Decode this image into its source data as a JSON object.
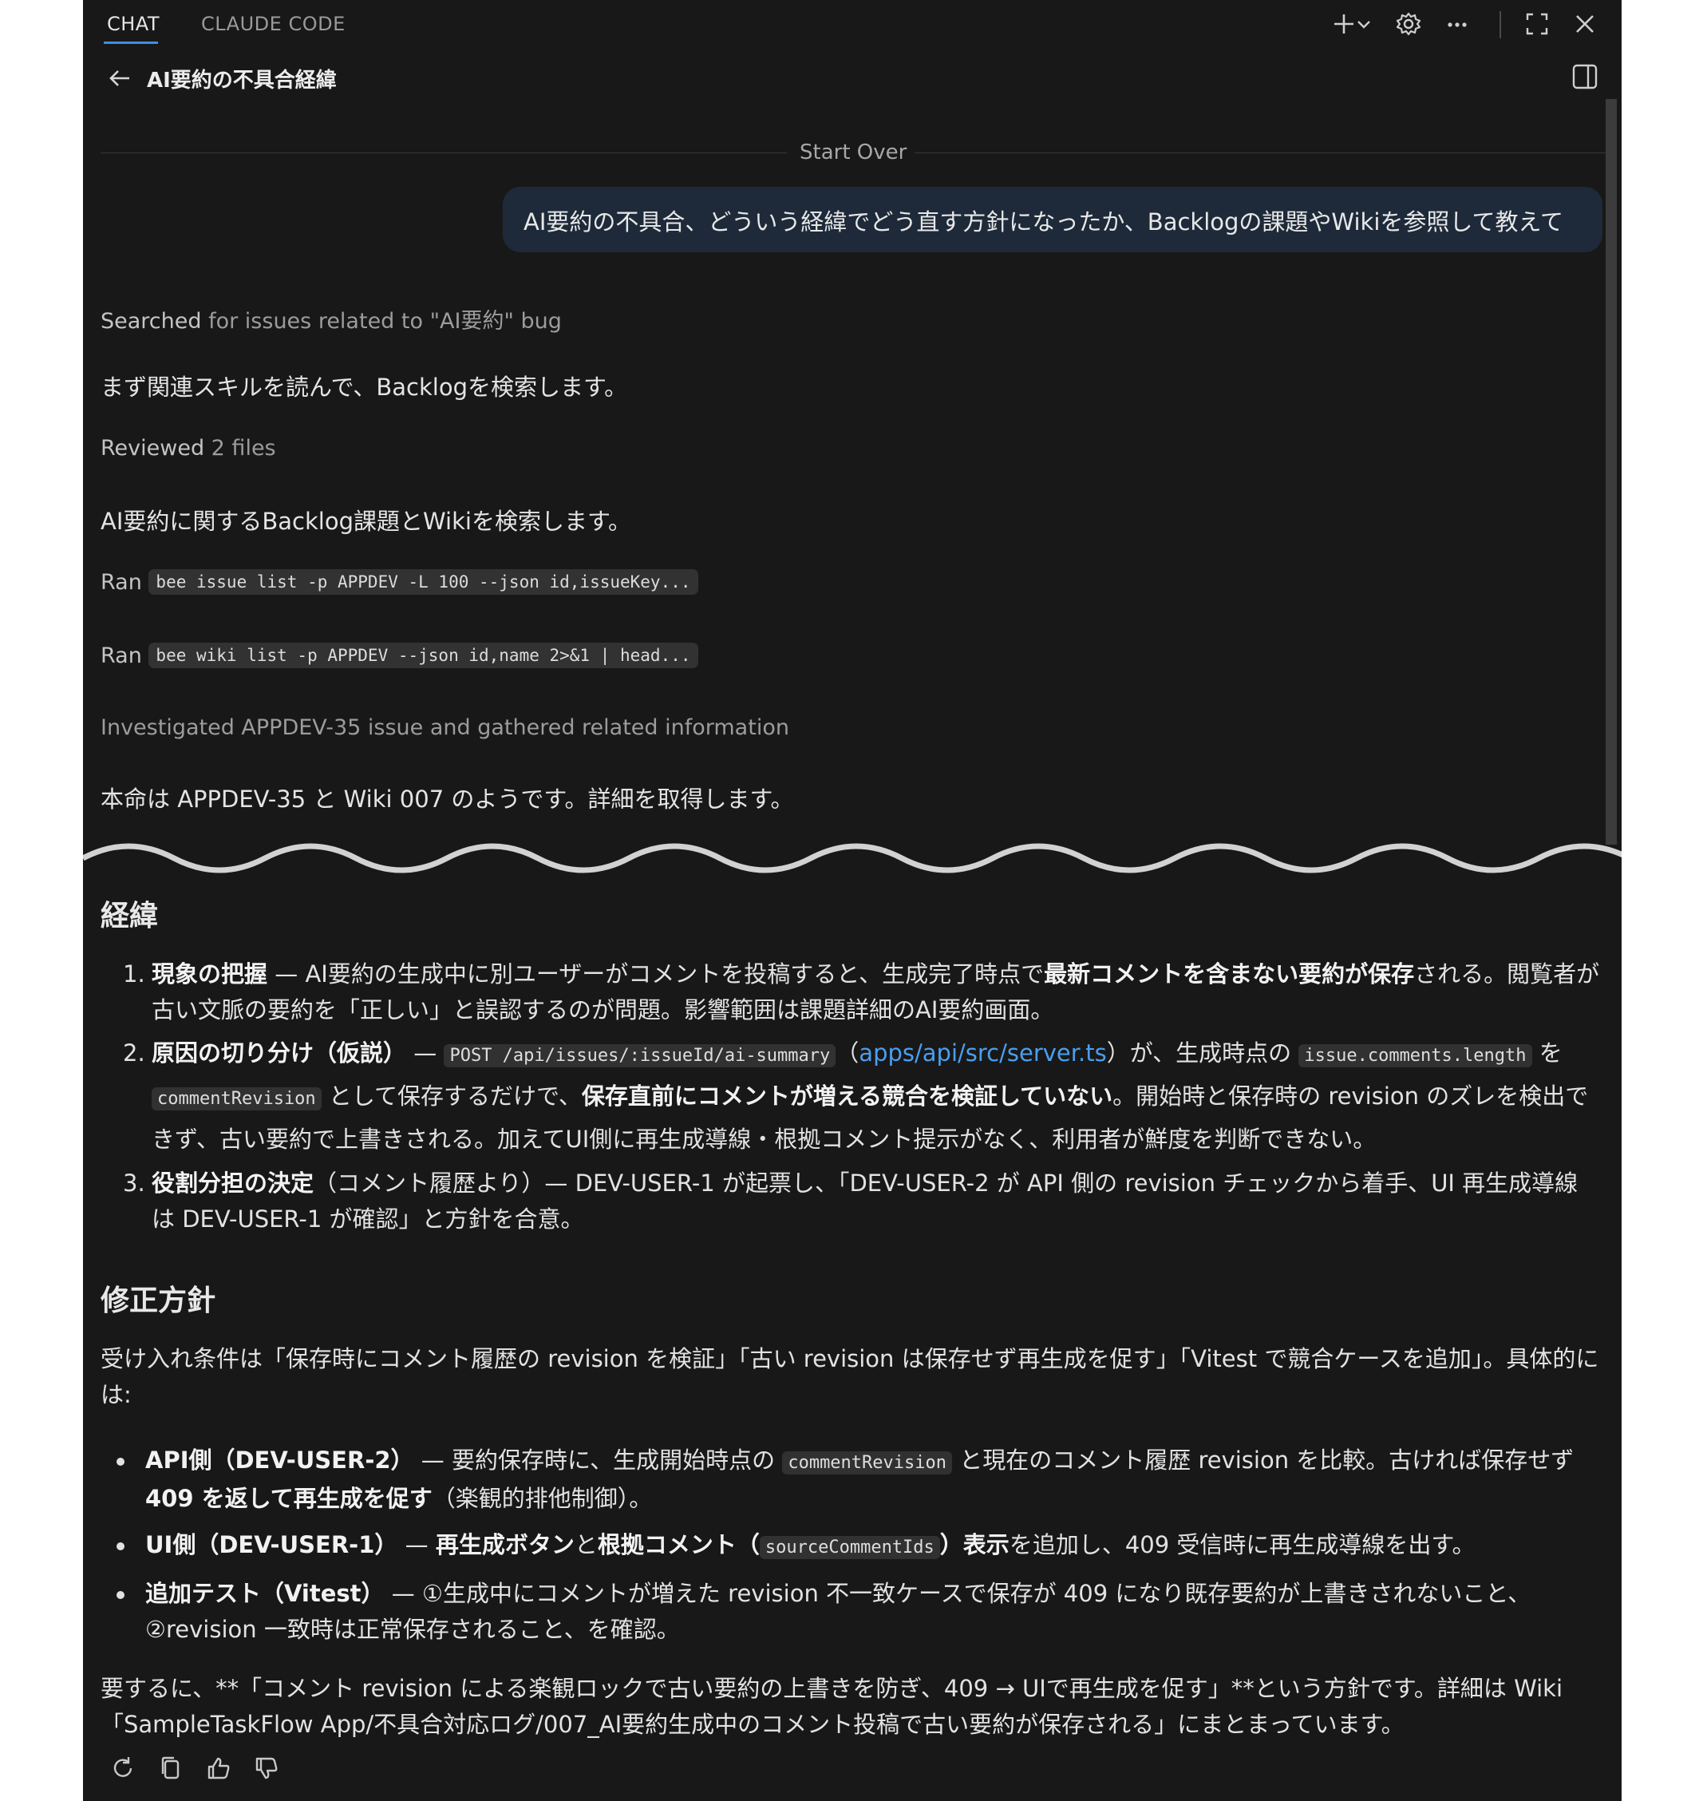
{
  "tabs": [
    {
      "label": "CHAT",
      "active": true
    },
    {
      "label": "CLAUDE CODE",
      "active": false
    }
  ],
  "toolbar_icons": [
    "plus-icon",
    "chevron-down-icon",
    "gear-icon",
    "more-icon",
    "expand-icon",
    "close-icon"
  ],
  "title": "AI要約の不具合経緯",
  "start_over": "Start Over",
  "user_message": "AI要約の不具合、どういう経緯でどう直す方針になったか、Backlogの課題やWikiを参照して教えて",
  "activity": {
    "searched_prefix": "Searched",
    "searched_rest": " for issues related to \"AI要約\" bug",
    "msg1": "まず関連スキルを読んで、Backlogを検索します。",
    "reviewed_prefix": "Reviewed",
    "reviewed_rest": " 2 files",
    "msg2": "AI要約に関するBacklog課題とWikiを検索します。",
    "ran_label": "Ran",
    "cmd1": "bee issue list -p APPDEV -L 100 --json id,issueKey...",
    "cmd2": "bee wiki list -p APPDEV --json id,name 2>&1 | head...",
    "investigated_prefix": "Investigated",
    "investigated_rest": " APPDEV-35 issue and gathered related information",
    "msg3": "本命は APPDEV-35 と Wiki 007 のようです。詳細を取得します。"
  },
  "section1": {
    "heading": "経緯",
    "items": [
      {
        "num": "1.",
        "b1": "現象の把握",
        "t1": " — AI要約の生成中に別ユーザーがコメントを投稿すると、生成完了時点で",
        "b2": "最新コメントを含まない要約が保存",
        "t2": "される。閲覧者が古い文脈の要約を「正しい」と誤認するのが問題。影響範囲は課題詳細のAI要約画面。"
      },
      {
        "num": "2.",
        "b1": "原因の切り分け（仮説）",
        "t1": " — ",
        "c1": "POST /api/issues/:issueId/ai-summary",
        "t2": "（",
        "link": "apps/api/src/server.ts",
        "t3": "）が、生成時点の ",
        "c2": "issue.comments.length",
        "t4": " を ",
        "c3": "commentRevision",
        "t5": " として保存するだけで、",
        "b2": "保存直前にコメントが増える競合を検証していない",
        "t6": "。開始時と保存時の revision のズレを検出できず、古い要約で上書きされる。加えてUI側に再生成導線・根拠コメント提示がなく、利用者が鮮度を判断できない。"
      },
      {
        "num": "3.",
        "b1": "役割分担の決定",
        "t1": "（コメント履歴より）— DEV-USER-1 が起票し、「DEV-USER-2 が API 側の revision チェックから着手、UI 再生成導線は DEV-USER-1 が確認」と方針を合意。"
      }
    ]
  },
  "section2": {
    "heading": "修正方針",
    "intro": "受け入れ条件は「保存時にコメント履歴の revision を検証」「古い revision は保存せず再生成を促す」「Vitest で競合ケースを追加」。具体的には:",
    "bullets": [
      {
        "b1": "API側（DEV-USER-2）",
        "t1": " — 要約保存時に、生成開始時点の ",
        "c1": "commentRevision",
        "t2": " と現在のコメント履歴 revision を比較。古ければ保存せず ",
        "b2": "409 を返して再生成を促す",
        "t3": "（楽観的排他制御）。"
      },
      {
        "b1": "UI側（DEV-USER-1）",
        "t1": " — ",
        "b2": "再生成ボタン",
        "t2": "と",
        "b3": "根拠コメント（",
        "c1": "sourceCommentIds",
        "b4": "）表示",
        "t3": "を追加し、409 受信時に再生成導線を出す。"
      },
      {
        "b1": "追加テスト（Vitest）",
        "t1": " — ①生成中にコメントが増えた revision 不一致ケースで保存が 409 になり既存要約が上書きされないこと、②revision 一致時は正常保存されること、を確認。"
      }
    ],
    "summary": "要するに、**「コメント revision による楽観ロックで古い要約の上書きを防ぎ、409 → UIで再生成を促す」**という方針です。詳細は Wiki「SampleTaskFlow App/不具合対応ログ/007_AI要約生成中のコメント投稿で古い要約が保存される」にまとまっています。"
  },
  "action_icons": [
    "retry-icon",
    "copy-icon",
    "thumbs-up-icon",
    "thumbs-down-icon"
  ]
}
